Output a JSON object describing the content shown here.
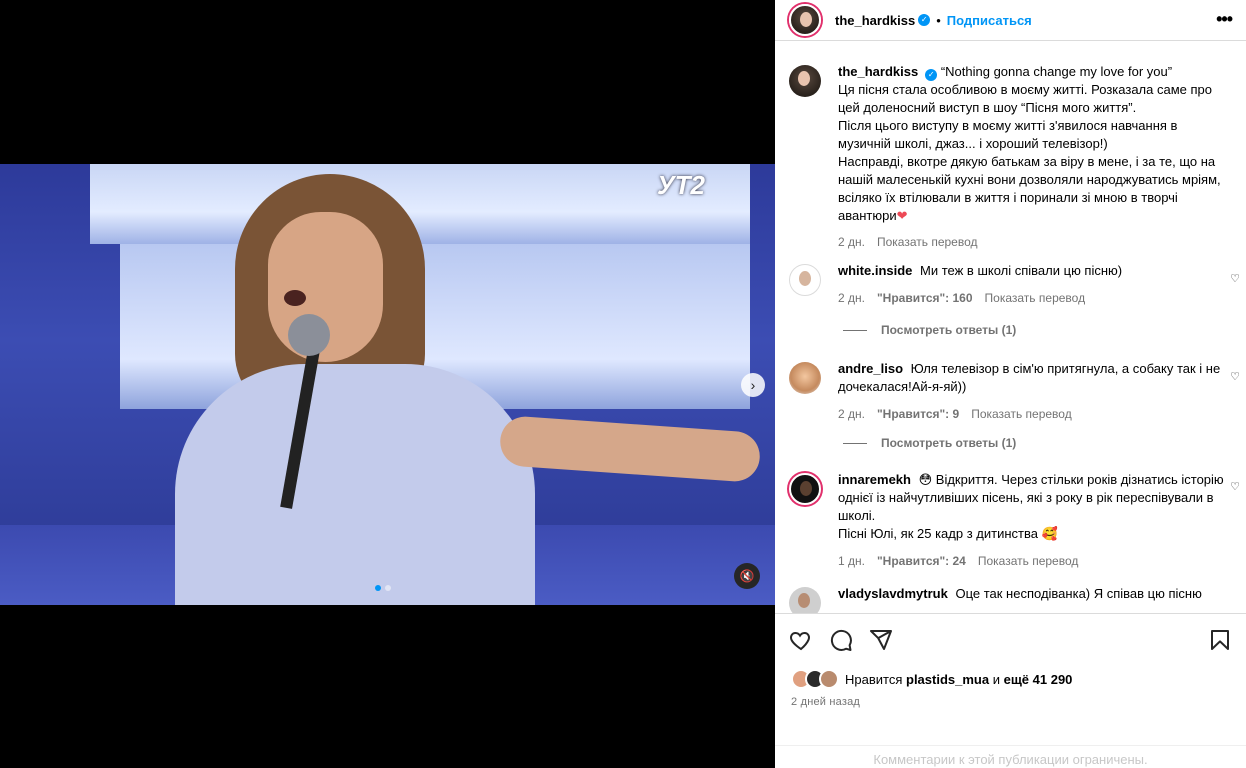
{
  "header": {
    "username": "the_hardkiss",
    "separator": "•",
    "follow_label": "Подписаться",
    "more_label": "•••"
  },
  "video": {
    "channel_logo": "УТ2",
    "next_label": "›",
    "mute_label": "🔇"
  },
  "caption": {
    "username": "the_hardkiss",
    "text_line1": "“Nothing gonna change my love for you”",
    "text_rest": "Ця пісня стала особливою в моєму житті. Розказала саме про цей доленосний виступ в шоу “Пісня мого життя”.\nПісля цього виступу в моєму житті з'явилося навчання в музичній школі, джаз... і хороший телевізор!)\nНасправді, вкотре дякую батькам за віру в мене, і за те, що на нашій малесенькій кухні вони дозволяли народжуватись мріям, всіляко їх втілювали в життя і поринали зі мною в творчі авантюри",
    "emoji": "❤",
    "time": "2 дн.",
    "translate": "Показать перевод"
  },
  "comments": [
    {
      "username": "white.inside",
      "text": "Ми теж в школі співали цю пісню)",
      "time": "2 дн.",
      "likes": "\"Нравится\": 160",
      "translate": "Показать перевод",
      "replies": "Посмотреть ответы (1)"
    },
    {
      "username": "andre_liso",
      "text": "Юля телевізор в сім'ю притягнула, а собаку так і не дочекалася!Ай-я-яй))",
      "time": "2 дн.",
      "likes": "\"Нравится\": 9",
      "translate": "Показать перевод",
      "replies": "Посмотреть ответы (1)"
    },
    {
      "username": "innaremekh",
      "text": "😳 Відкриття. Через стільки років дізнатись історію однієї із найчутливіших пісень, які з року в рік переспівували в школі.\nПісні Юлі, як 25 кадр з дитинства 🥰",
      "time": "1 дн.",
      "likes": "\"Нравится\": 24",
      "translate": "Показать перевод"
    },
    {
      "username": "vladyslavdmytruk",
      "text": "Оце так несподіванка) Я співав цю пісню"
    }
  ],
  "actions": {
    "like_icon": "heart-icon",
    "comment_icon": "comment-icon",
    "share_icon": "share-icon",
    "save_icon": "bookmark-icon"
  },
  "likes_summary": {
    "prefix": "Нравится",
    "user": "plastids_mua",
    "conj": "и",
    "others": "ещё 41 290"
  },
  "post_time": "2 дней назад",
  "comments_limited": "Комментарии к этой публикации ограничены."
}
